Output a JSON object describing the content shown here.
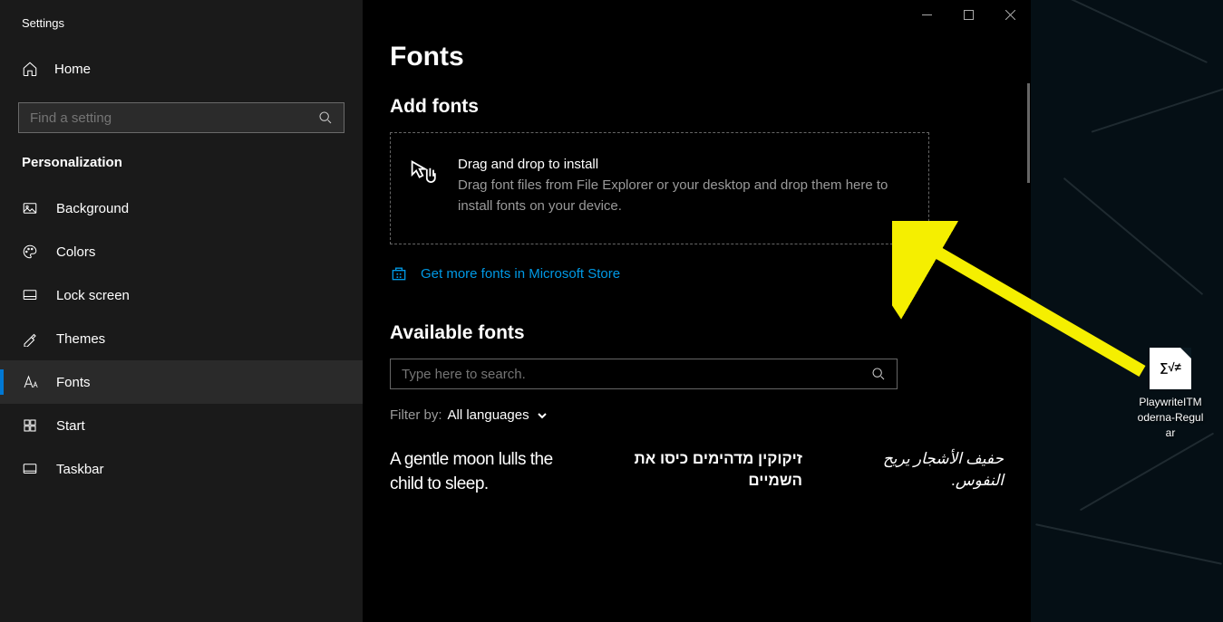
{
  "app_title": "Settings",
  "home_label": "Home",
  "search_placeholder": "Find a setting",
  "section_header": "Personalization",
  "nav_items": [
    {
      "key": "background",
      "label": "Background"
    },
    {
      "key": "colors",
      "label": "Colors"
    },
    {
      "key": "lockscreen",
      "label": "Lock screen"
    },
    {
      "key": "themes",
      "label": "Themes"
    },
    {
      "key": "fonts",
      "label": "Fonts",
      "active": true
    },
    {
      "key": "start",
      "label": "Start"
    },
    {
      "key": "taskbar",
      "label": "Taskbar"
    }
  ],
  "page_title": "Fonts",
  "add_fonts_heading": "Add fonts",
  "dropzone_title": "Drag and drop to install",
  "dropzone_desc": "Drag font files from File Explorer or your desktop and drop them here to install fonts on your device.",
  "store_link": "Get more fonts in Microsoft Store",
  "available_fonts_heading": "Available fonts",
  "font_search_placeholder": "Type here to search.",
  "filter_label": "Filter by:",
  "filter_value": "All languages",
  "font_previews": [
    "A gentle moon lulls the child to sleep.",
    "זיקוקין מדהימים כיסו את השמיים",
    "حفيف الأشجار يريح النفوس."
  ],
  "desktop_file": {
    "name": "PlaywriteITModerna-Regular",
    "glyph": "∑√≠"
  },
  "colors": {
    "accent": "#0078d4",
    "link": "#0099e5",
    "arrow": "#f5ef00"
  }
}
